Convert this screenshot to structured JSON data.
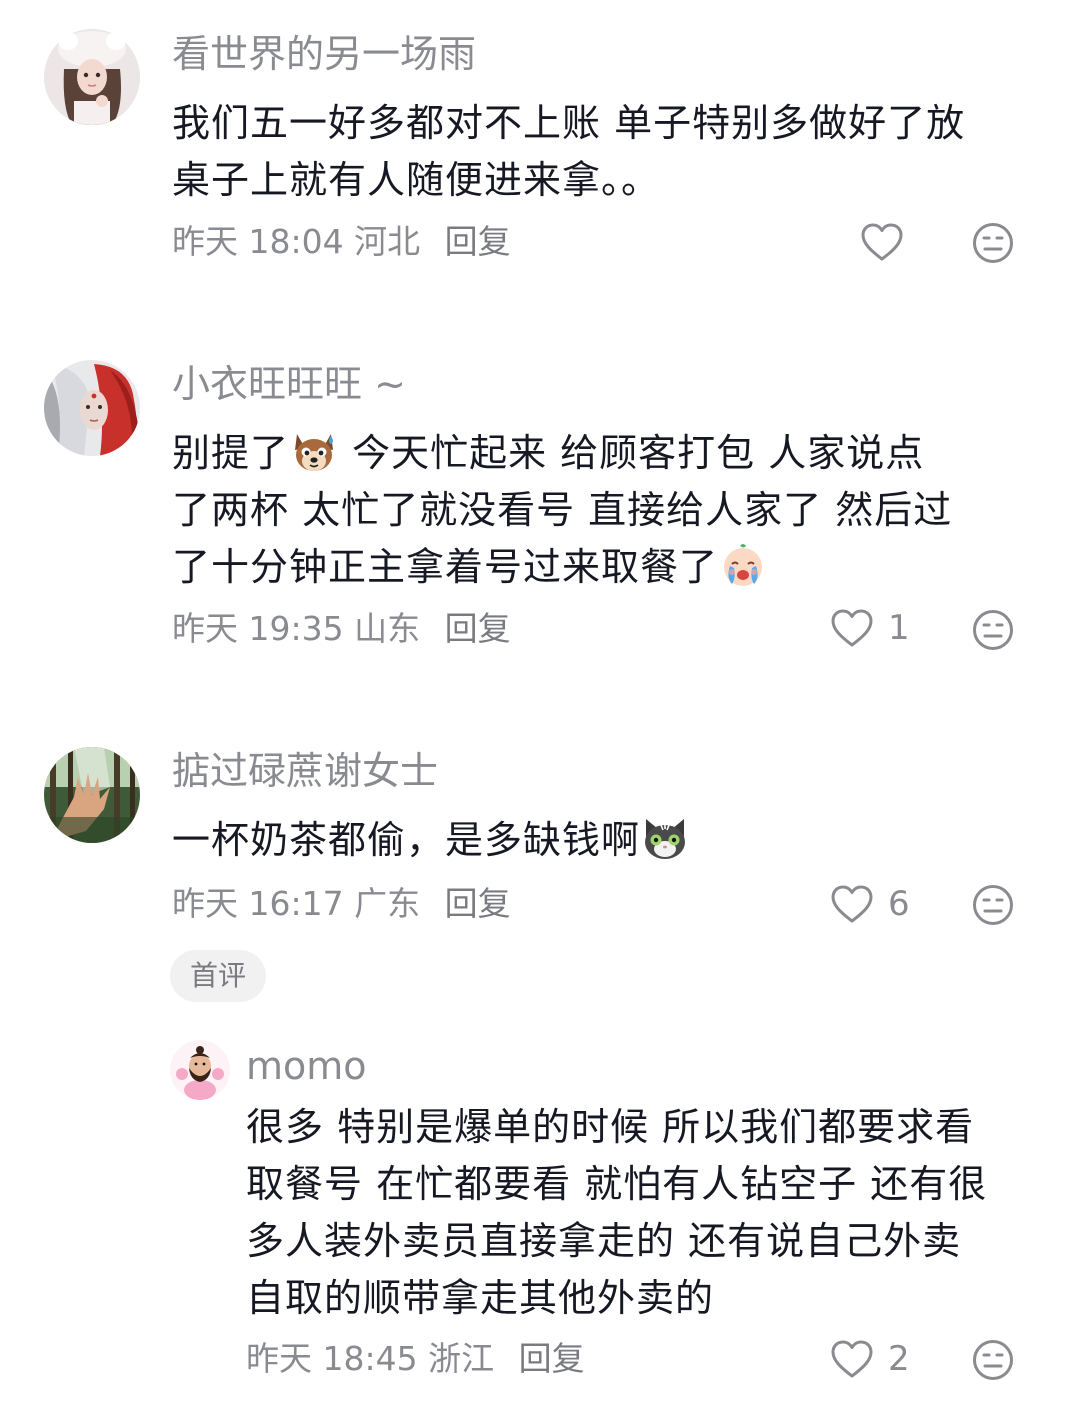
{
  "comments": [
    {
      "username": "看世界的另一场雨",
      "lines": [
        "我们五一好多都对不上账 单子特别多做好了放",
        "桌子上就有人随便进来拿。。"
      ],
      "time": "昨天 18:04",
      "location": "河北",
      "reply_label": "回复",
      "likes": "",
      "avatar_icon": "girl-avatar"
    },
    {
      "username": "小衣旺旺旺 ~",
      "line1_before": "别提了",
      "line1_after": " 今天忙起来  给顾客打包  人家说点",
      "line2": "了两杯  太忙了就没看号   直接给人家了  然后过",
      "line3": "了十分钟正主拿着号过来取餐了",
      "time": "昨天 19:35",
      "location": "山东",
      "reply_label": "回复",
      "likes": "1",
      "avatar_icon": "red-white-hair-avatar",
      "emoji1": "doge-sweat-emoji",
      "emoji2": "crying-baby-emoji"
    },
    {
      "username": "掂过碌蔗谢女士",
      "line1_before": "一杯奶茶都偷，是多缺钱啊",
      "time": "昨天 16:17",
      "location": "广东",
      "reply_label": "回复",
      "likes": "6",
      "badge": "首评",
      "avatar_icon": "forest-hand-avatar",
      "emoji1": "shocked-cat-emoji"
    }
  ],
  "reply": {
    "username": "momo",
    "lines": [
      "很多 特别是爆单的时候 所以我们都要求看",
      "取餐号 在忙都要看 就怕有人钻空子 还有很",
      "多人装外卖员直接拿走的 还有说自己外卖",
      "自取的顺带拿走其他外卖的"
    ],
    "time": "昨天 18:45",
    "location": "浙江",
    "reply_label": "回复",
    "likes": "2",
    "avatar_icon": "pink-muscle-man-avatar"
  },
  "colors": {
    "username": "#8a8b91",
    "content": "#161823",
    "meta": "#8a8b91",
    "badge_bg": "#f1f1f2"
  }
}
